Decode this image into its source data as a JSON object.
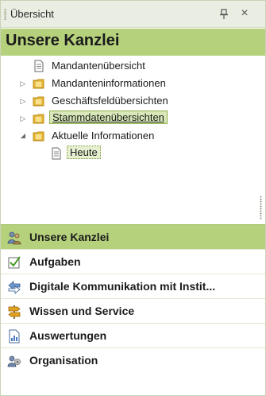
{
  "window": {
    "title": "Übersicht",
    "pin_icon": "pin-icon",
    "close_symbol": "×"
  },
  "section": {
    "title": "Unsere Kanzlei"
  },
  "tree": {
    "items": [
      {
        "label": "Mandantenübersicht",
        "icon": "document-icon",
        "expander": "",
        "state": "normal"
      },
      {
        "label": "Mandanteninformationen",
        "icon": "folder-icon",
        "expander": "▷",
        "state": "normal"
      },
      {
        "label": "Geschäftsfeldübersichten",
        "icon": "folder-icon",
        "expander": "▷",
        "state": "normal"
      },
      {
        "label": "Stammdatenübersichten",
        "icon": "folder-icon",
        "expander": "▷",
        "state": "selected"
      },
      {
        "label": "Aktuelle Informationen",
        "icon": "folder-icon",
        "expander": "◢",
        "state": "expanded"
      },
      {
        "label": "Heute",
        "icon": "document-icon",
        "expander": "",
        "state": "focused"
      }
    ]
  },
  "nav": {
    "items": [
      {
        "label": "Unsere Kanzlei",
        "icon": "people-icon",
        "active": true
      },
      {
        "label": "Aufgaben",
        "icon": "checkbox-icon",
        "active": false
      },
      {
        "label": "Digitale Kommunikation mit Instit...",
        "icon": "arrows-icon",
        "active": false
      },
      {
        "label": "Wissen und Service",
        "icon": "signpost-icon",
        "active": false
      },
      {
        "label": "Auswertungen",
        "icon": "report-icon",
        "active": false
      },
      {
        "label": "Organisation",
        "icon": "organisation-icon",
        "active": false
      }
    ]
  },
  "colors": {
    "accent_green": "#b5d17c",
    "titlebar_bg": "#e9ede2",
    "folder_yellow": "#f2c238"
  }
}
